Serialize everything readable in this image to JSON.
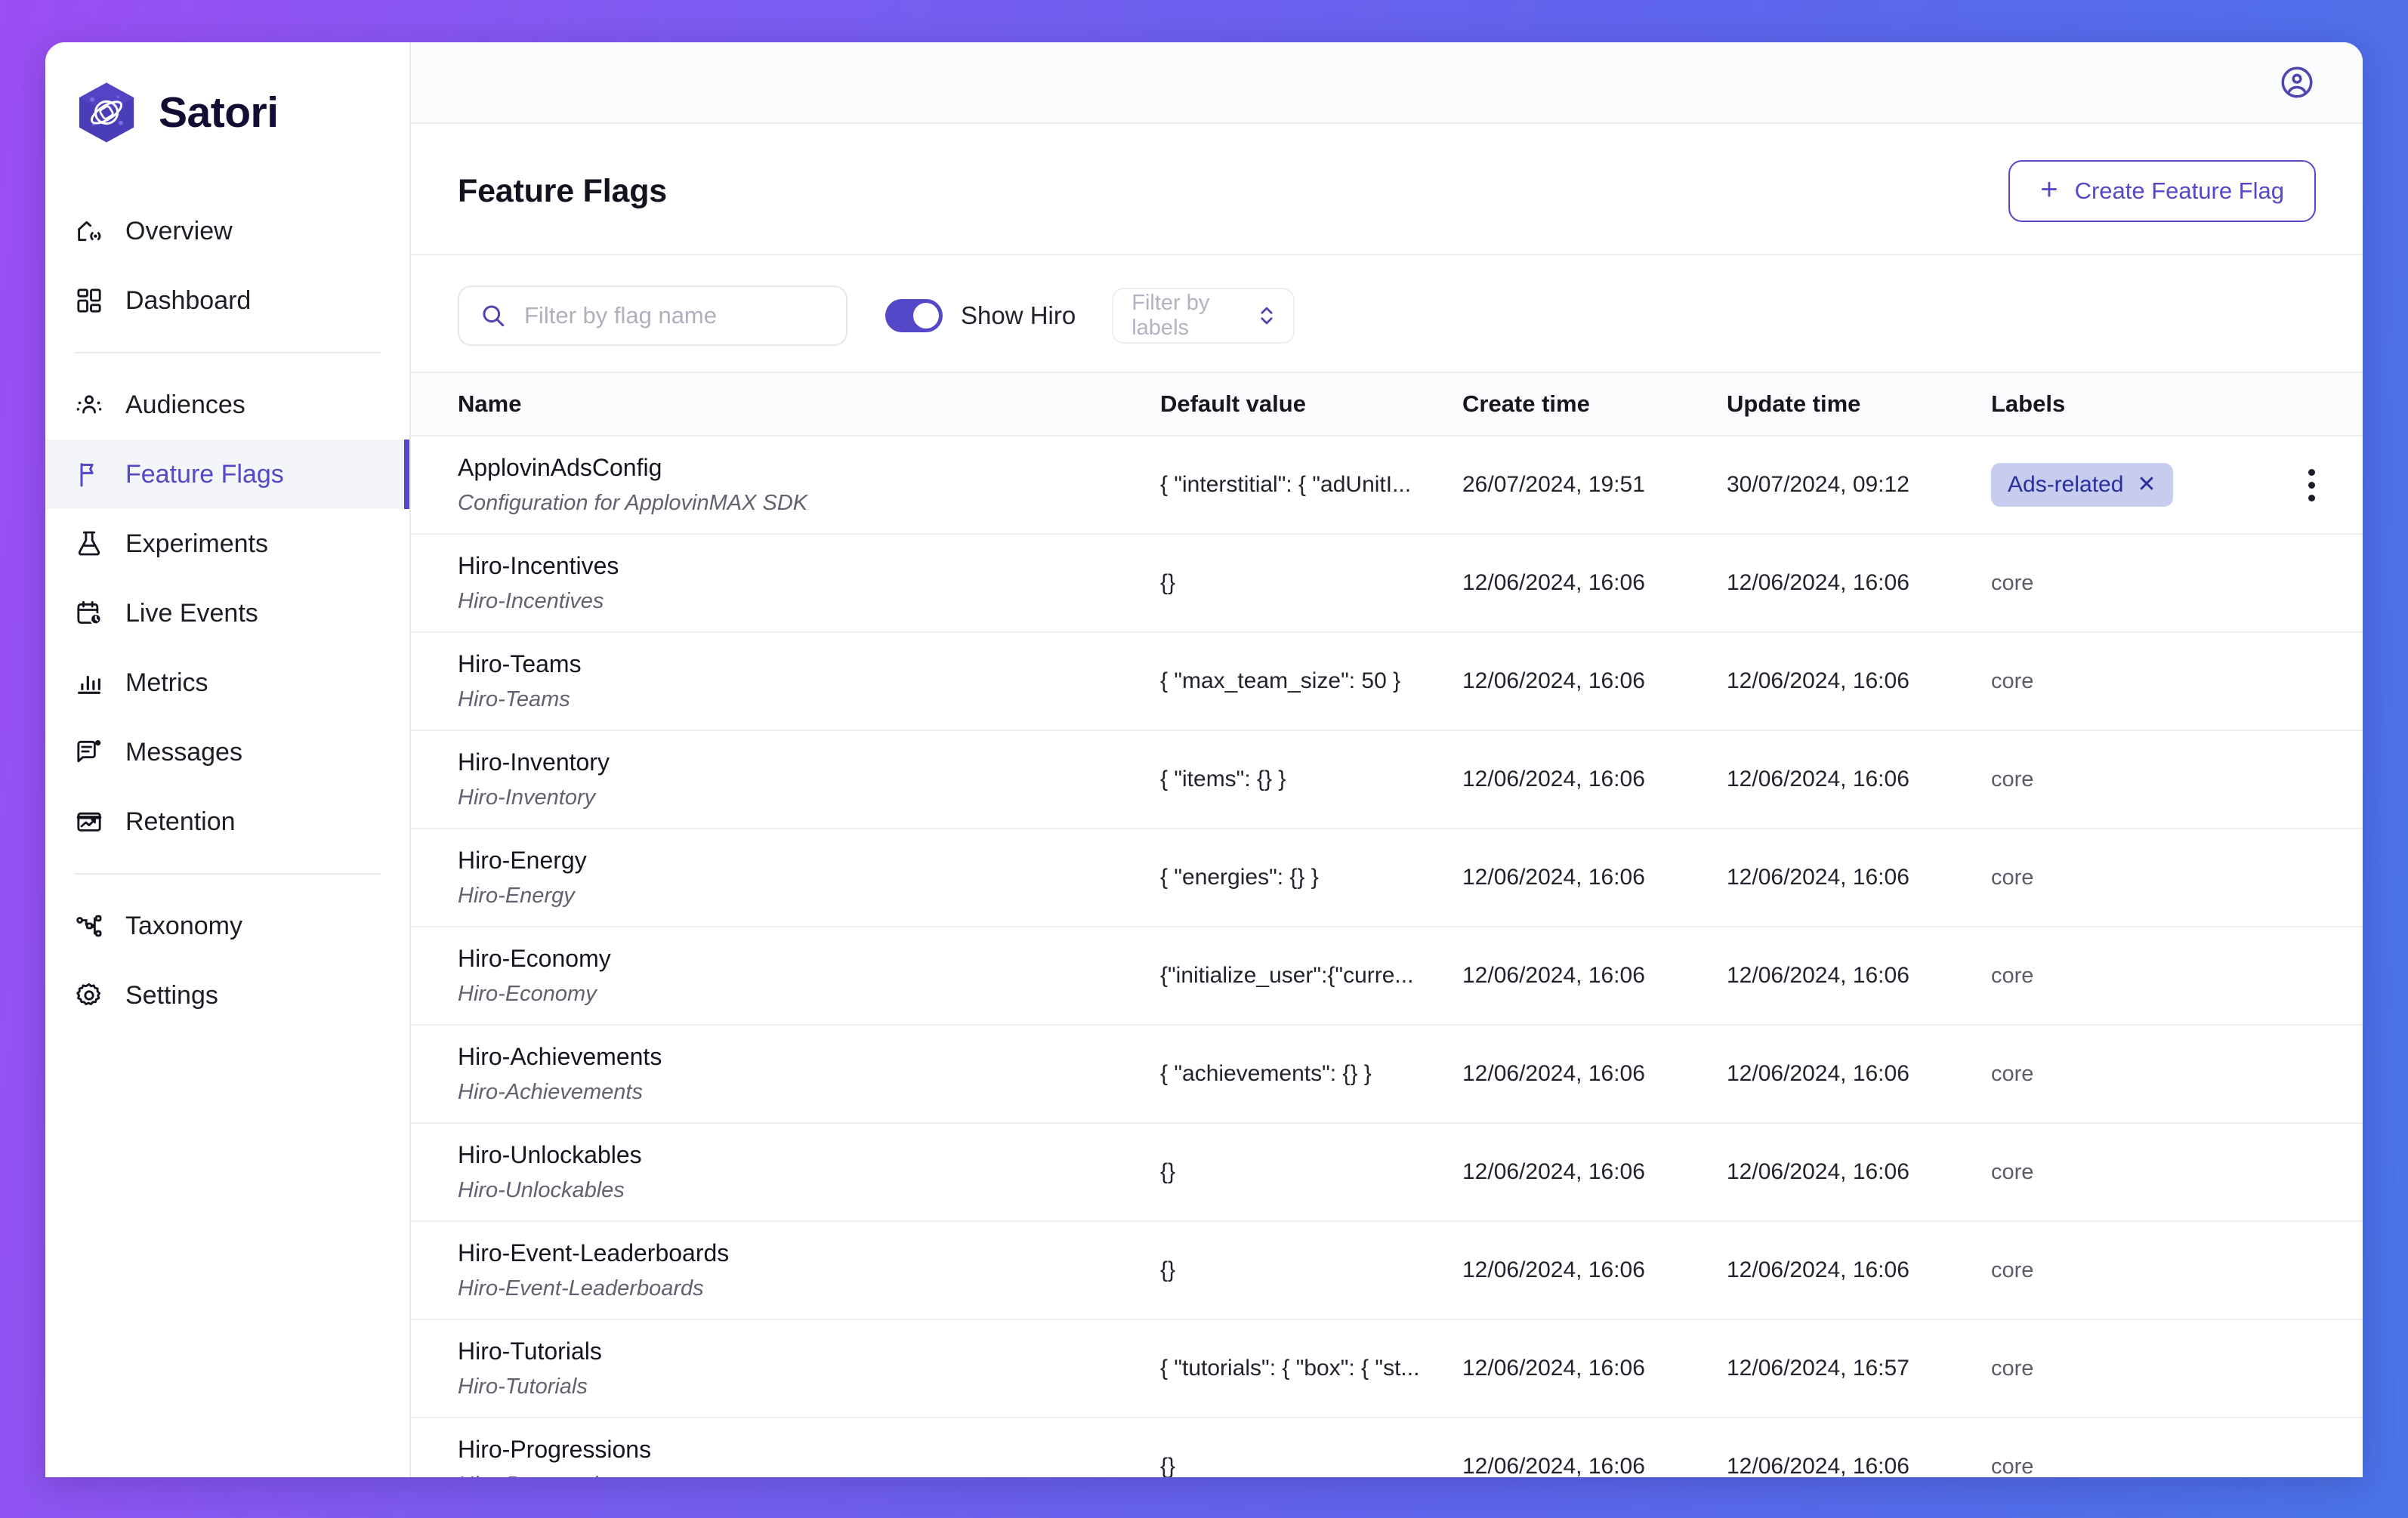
{
  "brand": {
    "name": "Satori",
    "logo_icon": "satori-hexagon-planet-logo"
  },
  "sidebar": {
    "groups": [
      {
        "items": [
          {
            "label": "Overview",
            "icon": "home-signal-icon",
            "active": false
          },
          {
            "label": "Dashboard",
            "icon": "grid-squares-icon",
            "active": false
          }
        ]
      },
      {
        "items": [
          {
            "label": "Audiences",
            "icon": "users-group-icon",
            "active": false
          },
          {
            "label": "Feature Flags",
            "icon": "flag-icon",
            "active": true
          },
          {
            "label": "Experiments",
            "icon": "flask-icon",
            "active": false
          },
          {
            "label": "Live Events",
            "icon": "calendar-clock-icon",
            "active": false
          },
          {
            "label": "Metrics",
            "icon": "bar-chart-icon",
            "active": false
          },
          {
            "label": "Messages",
            "icon": "message-dot-icon",
            "active": false
          },
          {
            "label": "Retention",
            "icon": "trend-window-icon",
            "active": false
          }
        ]
      },
      {
        "items": [
          {
            "label": "Taxonomy",
            "icon": "hierarchy-icon",
            "active": false
          },
          {
            "label": "Settings",
            "icon": "gear-icon",
            "active": false
          }
        ]
      }
    ]
  },
  "topbar": {
    "account_icon": "user-circle-icon"
  },
  "header": {
    "title": "Feature Flags",
    "create_button": {
      "label": "Create Feature Flag",
      "icon": "plus-icon"
    }
  },
  "filters": {
    "search": {
      "placeholder": "Filter by flag name",
      "value": "",
      "icon": "search-icon"
    },
    "show_hiro": {
      "label": "Show Hiro",
      "enabled": true
    },
    "labels_select": {
      "placeholder": "Filter by labels",
      "value": "",
      "icon": "chevron-up-down-icon"
    }
  },
  "table": {
    "columns": [
      "Name",
      "Default value",
      "Create time",
      "Update time",
      "Labels"
    ],
    "rows": [
      {
        "name": "ApplovinAdsConfig",
        "description": "Configuration for ApplovinMAX SDK",
        "default_value": "{ \"interstitial\": { \"adUnitI...",
        "create_time": "26/07/2024, 19:51",
        "update_time": "30/07/2024, 09:12",
        "label_badge": "Ads-related",
        "label_text": "",
        "has_menu": true
      },
      {
        "name": "Hiro-Incentives",
        "description": "Hiro-Incentives",
        "default_value": "{}",
        "create_time": "12/06/2024, 16:06",
        "update_time": "12/06/2024, 16:06",
        "label_badge": "",
        "label_text": "core",
        "has_menu": false
      },
      {
        "name": "Hiro-Teams",
        "description": "Hiro-Teams",
        "default_value": "{ \"max_team_size\": 50 }",
        "create_time": "12/06/2024, 16:06",
        "update_time": "12/06/2024, 16:06",
        "label_badge": "",
        "label_text": "core",
        "has_menu": false
      },
      {
        "name": "Hiro-Inventory",
        "description": "Hiro-Inventory",
        "default_value": "{ \"items\": {} }",
        "create_time": "12/06/2024, 16:06",
        "update_time": "12/06/2024, 16:06",
        "label_badge": "",
        "label_text": "core",
        "has_menu": false
      },
      {
        "name": "Hiro-Energy",
        "description": "Hiro-Energy",
        "default_value": "{ \"energies\": {} }",
        "create_time": "12/06/2024, 16:06",
        "update_time": "12/06/2024, 16:06",
        "label_badge": "",
        "label_text": "core",
        "has_menu": false
      },
      {
        "name": "Hiro-Economy",
        "description": "Hiro-Economy",
        "default_value": "{\"initialize_user\":{\"curre...",
        "create_time": "12/06/2024, 16:06",
        "update_time": "12/06/2024, 16:06",
        "label_badge": "",
        "label_text": "core",
        "has_menu": false
      },
      {
        "name": "Hiro-Achievements",
        "description": "Hiro-Achievements",
        "default_value": "{ \"achievements\": {} }",
        "create_time": "12/06/2024, 16:06",
        "update_time": "12/06/2024, 16:06",
        "label_badge": "",
        "label_text": "core",
        "has_menu": false
      },
      {
        "name": "Hiro-Unlockables",
        "description": "Hiro-Unlockables",
        "default_value": "{}",
        "create_time": "12/06/2024, 16:06",
        "update_time": "12/06/2024, 16:06",
        "label_badge": "",
        "label_text": "core",
        "has_menu": false
      },
      {
        "name": "Hiro-Event-Leaderboards",
        "description": "Hiro-Event-Leaderboards",
        "default_value": "{}",
        "create_time": "12/06/2024, 16:06",
        "update_time": "12/06/2024, 16:06",
        "label_badge": "",
        "label_text": "core",
        "has_menu": false
      },
      {
        "name": "Hiro-Tutorials",
        "description": "Hiro-Tutorials",
        "default_value": "{ \"tutorials\": { \"box\": { \"st...",
        "create_time": "12/06/2024, 16:06",
        "update_time": "12/06/2024, 16:57",
        "label_badge": "",
        "label_text": "core",
        "has_menu": false
      },
      {
        "name": "Hiro-Progressions",
        "description": "Hiro-Progressions",
        "default_value": "{}",
        "create_time": "12/06/2024, 16:06",
        "update_time": "12/06/2024, 16:06",
        "label_badge": "",
        "label_text": "core",
        "has_menu": false
      }
    ]
  },
  "colors": {
    "accent": "#5448c8",
    "badge_bg": "#c8cdf0",
    "badge_text": "#2a2f9e",
    "bg_gradient_from": "#9b4ef2",
    "bg_gradient_to": "#4a74e8"
  }
}
